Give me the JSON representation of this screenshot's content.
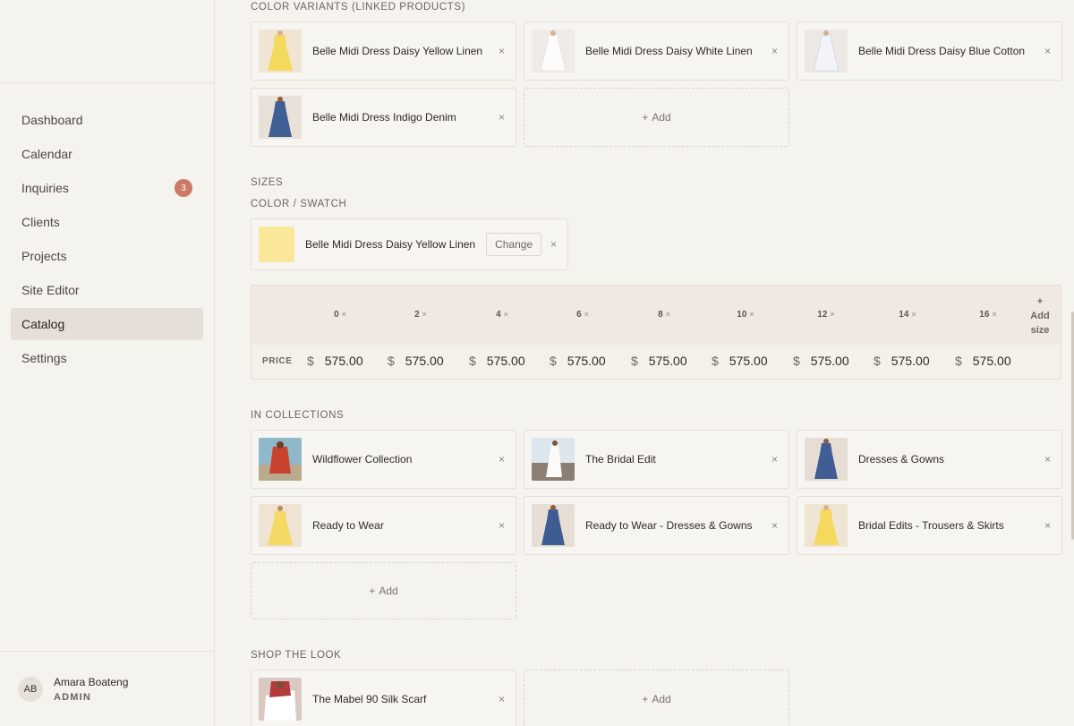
{
  "sidebar": {
    "items": [
      {
        "label": "Dashboard"
      },
      {
        "label": "Calendar"
      },
      {
        "label": "Inquiries",
        "badge": "3"
      },
      {
        "label": "Clients"
      },
      {
        "label": "Projects"
      },
      {
        "label": "Site Editor"
      },
      {
        "label": "Catalog",
        "active": true
      },
      {
        "label": "Settings"
      }
    ],
    "user": {
      "initials": "AB",
      "name": "Amara Boateng",
      "role": "ADMIN"
    }
  },
  "color_variants": {
    "label": "COLOR VARIANTS (LINKED PRODUCTS)",
    "items": [
      {
        "label": "Belle Midi Dress Daisy Yellow Linen"
      },
      {
        "label": "Belle Midi Dress Daisy White Linen"
      },
      {
        "label": "Belle Midi Dress Daisy Blue Cotton"
      },
      {
        "label": "Belle Midi Dress Indigo Denim"
      }
    ],
    "add_label": "Add"
  },
  "sizes": {
    "label": "SIZES",
    "swatch_label": "COLOR / SWATCH",
    "swatch_name": "Belle Midi Dress Daisy Yellow Linen",
    "swatch_color": "#fbe79a",
    "change_label": "Change",
    "columns": [
      "0",
      "2",
      "4",
      "6",
      "8",
      "10",
      "12",
      "14",
      "16"
    ],
    "add_size_plus": "+",
    "add_size_label": "Add size",
    "price_label": "PRICE",
    "currency": "$",
    "prices": [
      "575.00",
      "575.00",
      "575.00",
      "575.00",
      "575.00",
      "575.00",
      "575.00",
      "575.00",
      "575.00"
    ]
  },
  "collections": {
    "label": "IN COLLECTIONS",
    "items": [
      {
        "label": "Wildflower Collection"
      },
      {
        "label": "The Bridal Edit"
      },
      {
        "label": "Dresses & Gowns"
      },
      {
        "label": "Ready to Wear"
      },
      {
        "label": "Ready to Wear - Dresses & Gowns"
      },
      {
        "label": "Bridal Edits - Trousers & Skirts"
      }
    ],
    "add_label": "Add"
  },
  "shop_the_look": {
    "label": "SHOP THE LOOK",
    "items": [
      {
        "label": "The Mabel 90 Silk Scarf"
      }
    ],
    "add_label": "Add"
  },
  "icons": {
    "remove": "×",
    "plus": "+"
  },
  "colors": {
    "accent_badge": "#cb7a66",
    "active_nav": "#e6dfd7",
    "background": "#f5f3ee"
  }
}
